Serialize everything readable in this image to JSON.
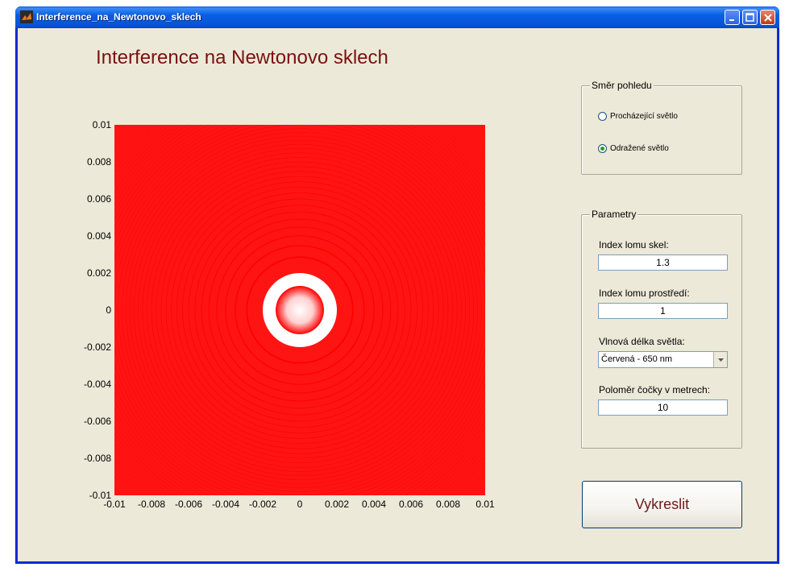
{
  "window": {
    "title": "Interference_na_Newtonovo_sklech",
    "minimize_icon": "minimize-icon",
    "maximize_icon": "maximize-icon",
    "close_icon": "close-icon"
  },
  "app": {
    "heading": "Interference na Newtonovo sklech"
  },
  "plot": {
    "y_ticks": [
      "0.01",
      "0.008",
      "0.006",
      "0.004",
      "0.002",
      "0",
      "-0.002",
      "-0.004",
      "-0.006",
      "-0.008",
      "-0.01"
    ],
    "x_ticks": [
      "-0.01",
      "-0.008",
      "-0.006",
      "-0.004",
      "-0.002",
      "0",
      "0.002",
      "0.004",
      "0.006",
      "0.008",
      "0.01"
    ],
    "xlim": [
      -0.01,
      0.01
    ],
    "ylim": [
      -0.01,
      0.01
    ],
    "color": "#ff0000"
  },
  "view_group": {
    "legend": "Směr pohledu",
    "options": [
      {
        "label": "Procházející světlo",
        "checked": false
      },
      {
        "label": "Odražené světlo",
        "checked": true
      }
    ]
  },
  "params": {
    "legend": "Parametry",
    "glass_index_label": "Index lomu skel:",
    "glass_index_value": "1.3",
    "medium_index_label": "Index lomu prostředí:",
    "medium_index_value": "1",
    "wavelength_label": "Vlnová délka světla:",
    "wavelength_value": "Červená - 650 nm",
    "radius_label": "Poloměr čočky v metrech:",
    "radius_value": "10"
  },
  "actions": {
    "draw_label": "Vykreslit"
  }
}
